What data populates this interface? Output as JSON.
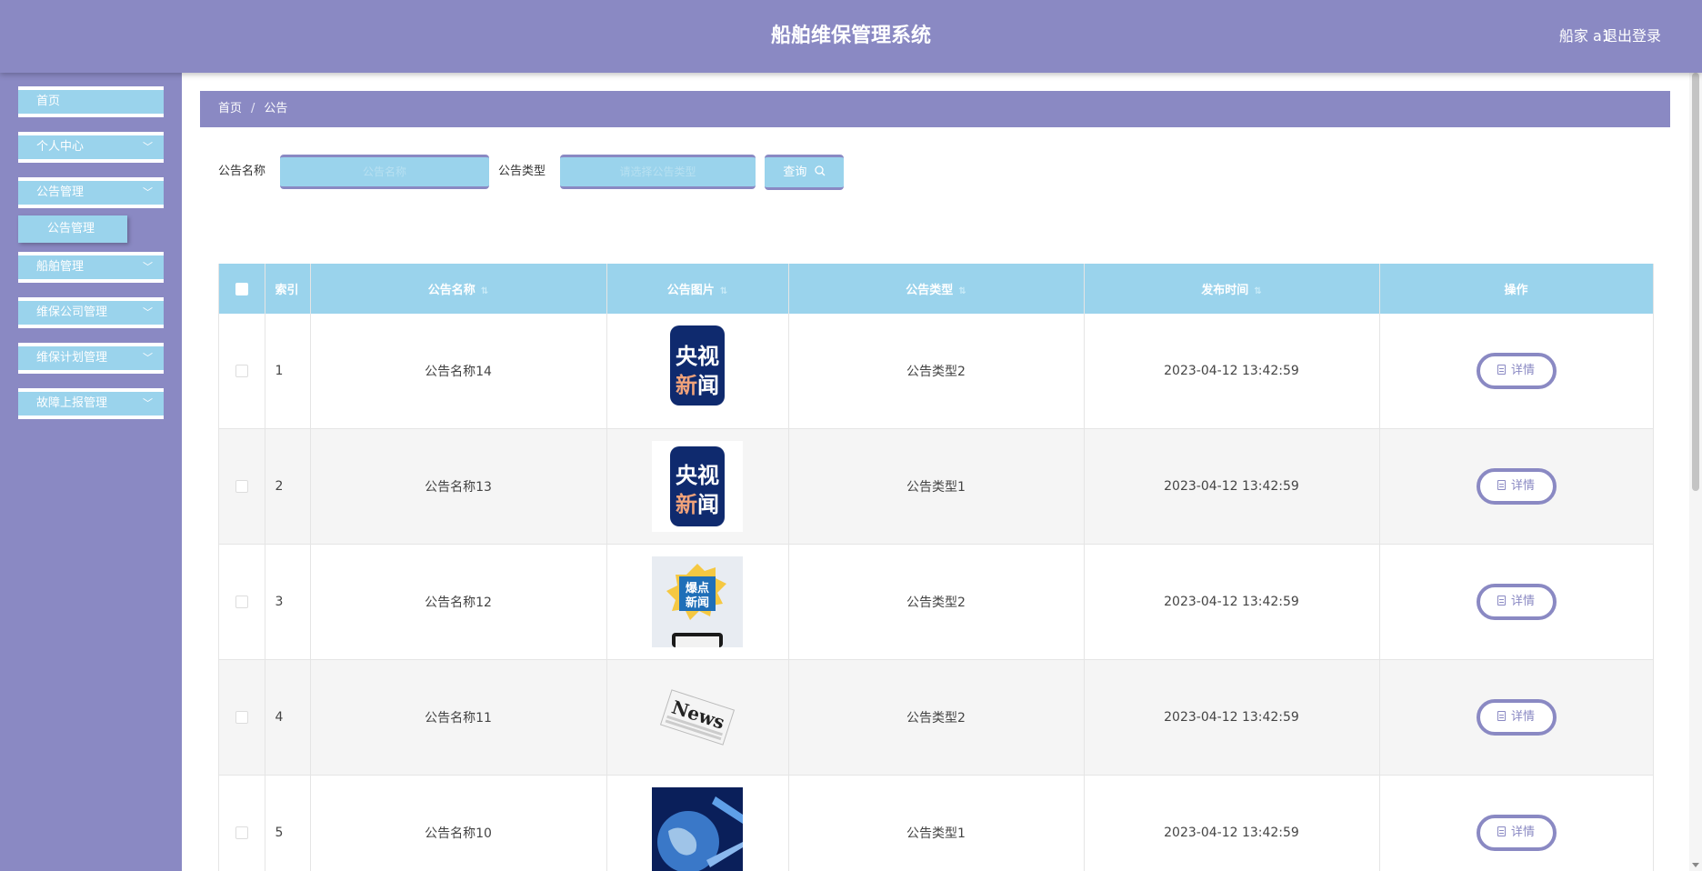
{
  "header": {
    "title": "船舶维保管理系统",
    "user": "船家 a1",
    "logout": "退出登录"
  },
  "sidebar": {
    "items": [
      {
        "label": "首页"
      },
      {
        "label": "个人中心"
      },
      {
        "label": "公告管理"
      },
      {
        "label": "船舶管理"
      },
      {
        "label": "维保公司管理"
      },
      {
        "label": "维保计划管理"
      },
      {
        "label": "故障上报管理"
      }
    ],
    "active_sub": "公告管理"
  },
  "breadcrumb": {
    "home": "首页",
    "separator": "/",
    "current": "公告"
  },
  "search": {
    "name_label": "公告名称",
    "name_placeholder": "公告名称",
    "type_label": "公告类型",
    "type_placeholder": "请选择公告类型",
    "button_label": "查询"
  },
  "table": {
    "headers": [
      "索引",
      "公告名称",
      "公告图片",
      "公告类型",
      "发布时间",
      "操作"
    ],
    "rows": [
      {
        "index": "1",
        "name": "公告名称14",
        "type": "公告类型2",
        "time": "2023-04-12 13:42:59",
        "image": "cctv-news"
      },
      {
        "index": "2",
        "name": "公告名称13",
        "type": "公告类型1",
        "time": "2023-04-12 13:42:59",
        "image": "cctv-news"
      },
      {
        "index": "3",
        "name": "公告名称12",
        "type": "公告类型2",
        "time": "2023-04-12 13:42:59",
        "image": "hot-news"
      },
      {
        "index": "4",
        "name": "公告名称11",
        "type": "公告类型2",
        "time": "2023-04-12 13:42:59",
        "image": "newspaper"
      },
      {
        "index": "5",
        "name": "公告名称10",
        "type": "公告类型1",
        "time": "2023-04-12 13:42:59",
        "image": "globe"
      }
    ],
    "detail_label": "详情"
  },
  "thumbnails": {
    "cctv": {
      "line1": "央视",
      "line2a": "新",
      "line2b": "闻"
    },
    "hot": {
      "line1": "爆点",
      "line2": "新闻"
    },
    "paper": {
      "word": "News"
    }
  },
  "colors": {
    "primary": "#8a89c3",
    "accent": "#9ad3ec"
  }
}
